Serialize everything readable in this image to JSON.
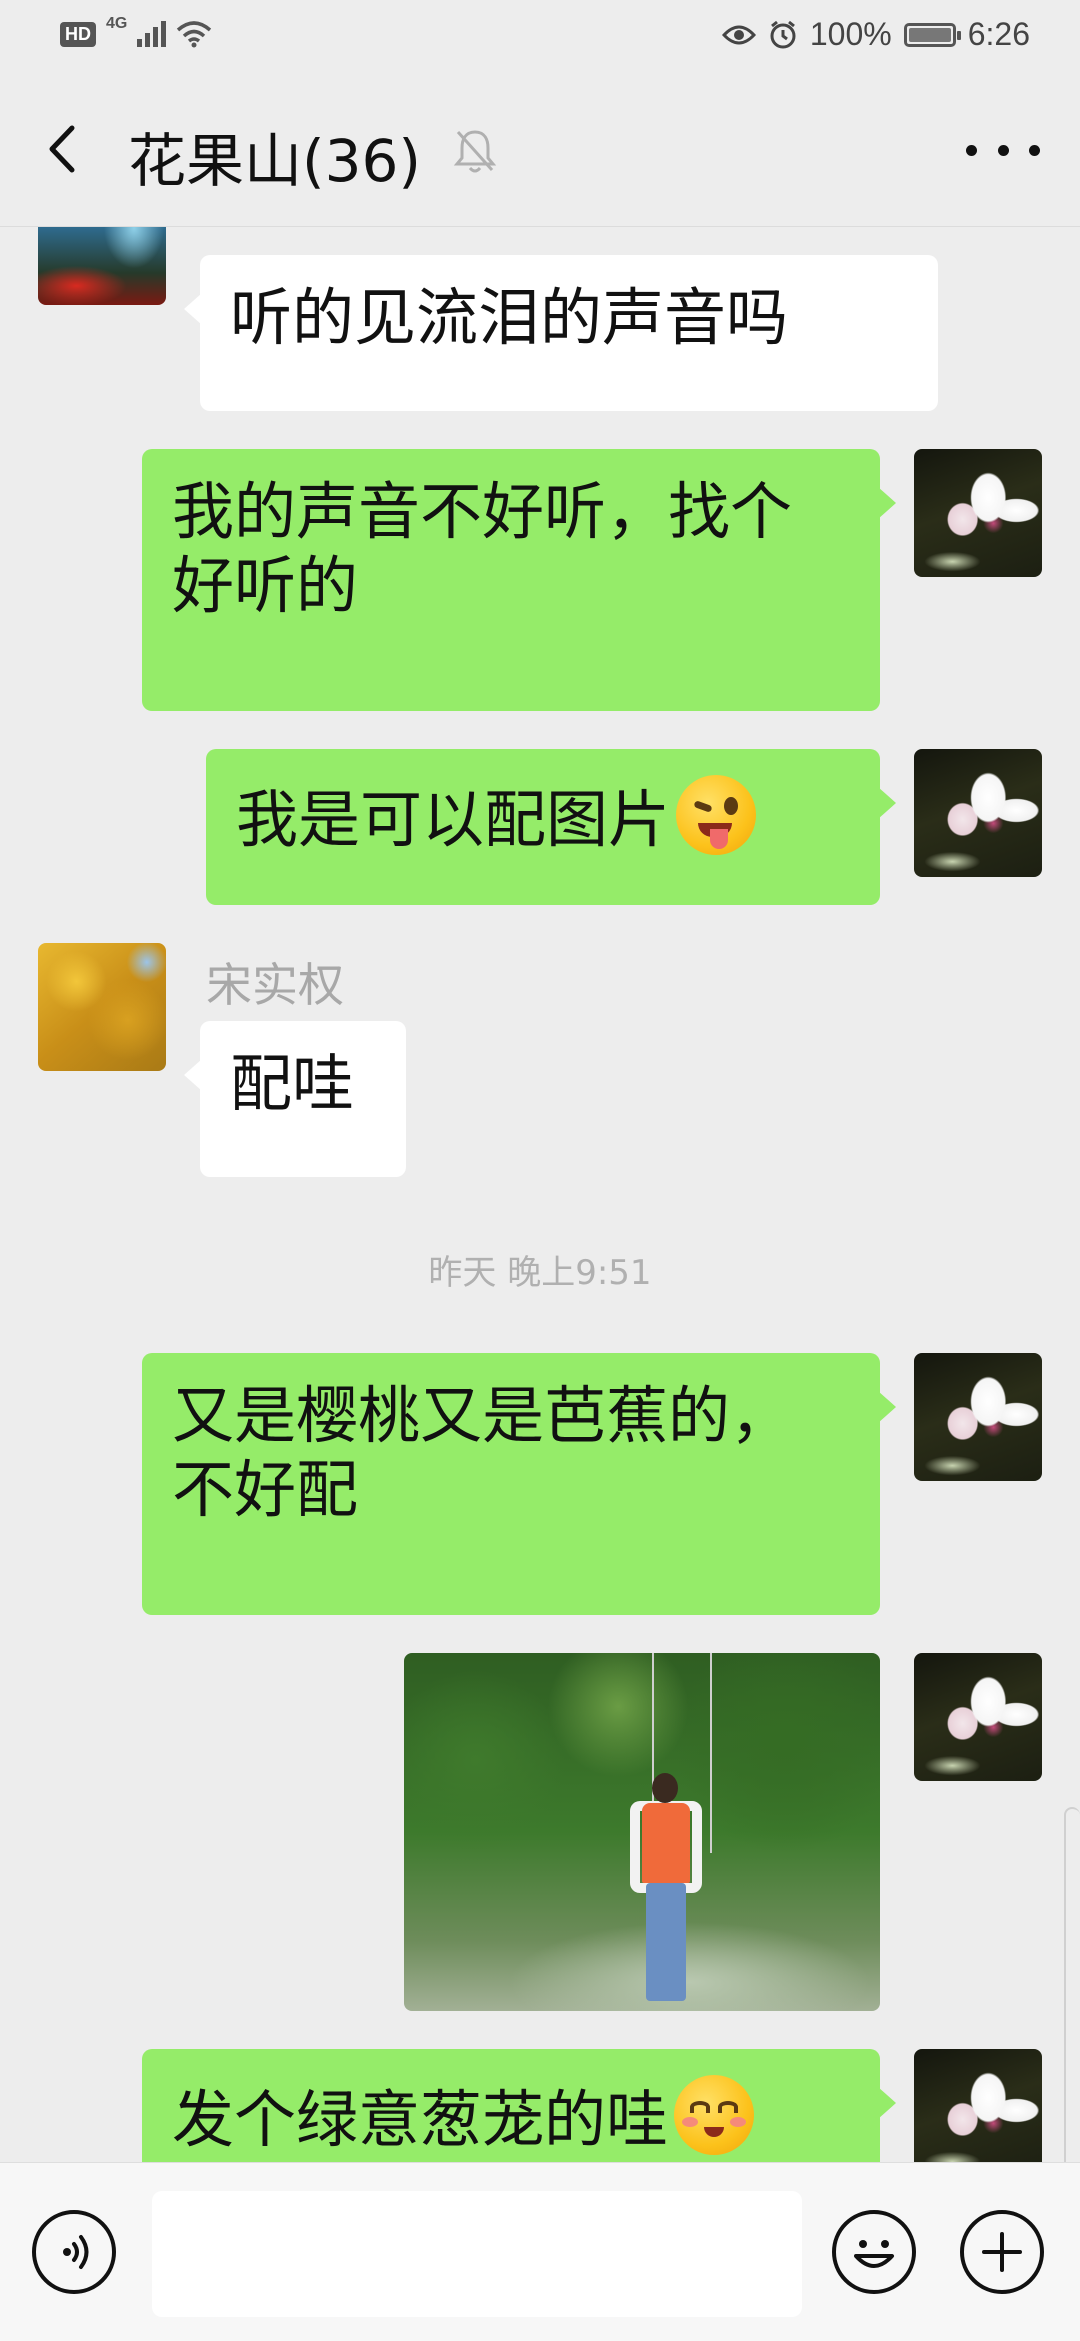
{
  "status_bar": {
    "network": "4G",
    "hd": "HD",
    "battery": "100%",
    "time": "6:26",
    "icons": [
      "eye-icon",
      "alarm-icon",
      "wifi-icon",
      "signal-icon",
      "battery-icon"
    ]
  },
  "header": {
    "title": "花果山(36)",
    "icons": [
      "back-arrow-icon",
      "mute-bell-icon",
      "more-dots-icon"
    ]
  },
  "messages": [
    {
      "id": "m1",
      "direction": "incoming",
      "sender": "",
      "avatar": "landscape-photo",
      "text": "听的见流泪的声音吗"
    },
    {
      "id": "m2",
      "direction": "outgoing",
      "avatar": "white-flower-photo",
      "text": "我的声音不好听，找个好听的"
    },
    {
      "id": "m3",
      "direction": "outgoing",
      "avatar": "white-flower-photo",
      "text": "我是可以配图片",
      "emoji": "wink-tongue-emoji"
    },
    {
      "id": "m4",
      "direction": "incoming",
      "sender": "宋实权",
      "avatar": "ginkgo-photo",
      "text": "配哇"
    },
    {
      "id": "m5",
      "direction": "outgoing",
      "avatar": "white-flower-photo",
      "text": "又是樱桃又是芭蕉的，不好配"
    },
    {
      "id": "m6",
      "direction": "outgoing",
      "avatar": "white-flower-photo",
      "image": "photo-woman-on-swing-green-vines"
    },
    {
      "id": "m7",
      "direction": "outgoing",
      "avatar": "white-flower-photo",
      "text": "发个绿意葱茏的哇",
      "emoji": "shy-smile-emoji"
    }
  ],
  "timestamp": "昨天 晚上9:51",
  "input_bar": {
    "value": "",
    "icons": [
      "voice-icon",
      "emoji-icon",
      "plus-icon"
    ]
  },
  "colors": {
    "background": "#ededed",
    "outgoing_bubble": "#95ec69",
    "incoming_bubble": "#ffffff",
    "timestamp_text": "#b0b0b0",
    "sender_name": "#a8a8a8"
  }
}
